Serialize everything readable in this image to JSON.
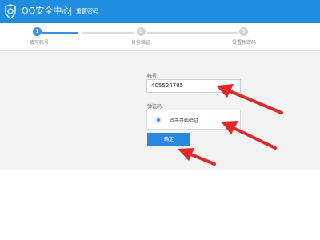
{
  "header": {
    "brand": "QQ安全中心",
    "subtitle": "重置密码",
    "logo_icon": "shield-icon",
    "bg_color": "#1f8ee0"
  },
  "steps": [
    {
      "number": "1",
      "label": "填写帐号",
      "state": "active"
    },
    {
      "number": "2",
      "label": "身份验证",
      "state": "inactive"
    },
    {
      "number": "3",
      "label": "设置新密码",
      "state": "inactive"
    }
  ],
  "form": {
    "account_label": "帐号:",
    "account_value": "405524785",
    "verify_label": "验证码:",
    "verify_text": "点击开始验证",
    "confirm_label": "确定"
  },
  "annotations": {
    "arrow_color": "#e02a2a"
  }
}
